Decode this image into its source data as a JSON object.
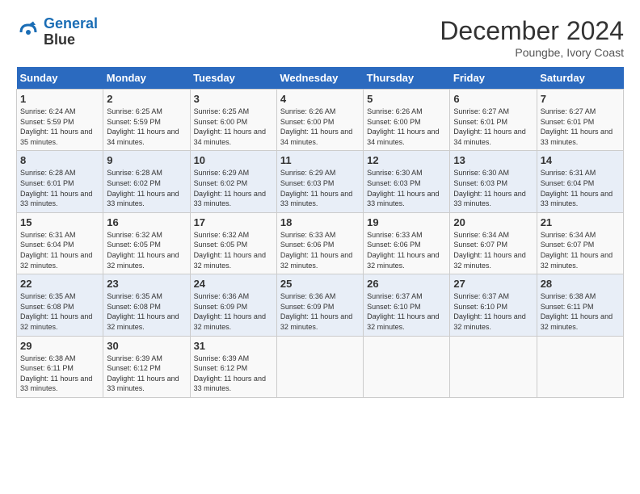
{
  "header": {
    "logo_line1": "General",
    "logo_line2": "Blue",
    "month": "December 2024",
    "location": "Poungbe, Ivory Coast"
  },
  "days_of_week": [
    "Sunday",
    "Monday",
    "Tuesday",
    "Wednesday",
    "Thursday",
    "Friday",
    "Saturday"
  ],
  "weeks": [
    [
      {
        "day": "1",
        "sunrise": "6:24 AM",
        "sunset": "5:59 PM",
        "daylight": "11 hours and 35 minutes."
      },
      {
        "day": "2",
        "sunrise": "6:25 AM",
        "sunset": "5:59 PM",
        "daylight": "11 hours and 34 minutes."
      },
      {
        "day": "3",
        "sunrise": "6:25 AM",
        "sunset": "6:00 PM",
        "daylight": "11 hours and 34 minutes."
      },
      {
        "day": "4",
        "sunrise": "6:26 AM",
        "sunset": "6:00 PM",
        "daylight": "11 hours and 34 minutes."
      },
      {
        "day": "5",
        "sunrise": "6:26 AM",
        "sunset": "6:00 PM",
        "daylight": "11 hours and 34 minutes."
      },
      {
        "day": "6",
        "sunrise": "6:27 AM",
        "sunset": "6:01 PM",
        "daylight": "11 hours and 34 minutes."
      },
      {
        "day": "7",
        "sunrise": "6:27 AM",
        "sunset": "6:01 PM",
        "daylight": "11 hours and 33 minutes."
      }
    ],
    [
      {
        "day": "8",
        "sunrise": "6:28 AM",
        "sunset": "6:01 PM",
        "daylight": "11 hours and 33 minutes."
      },
      {
        "day": "9",
        "sunrise": "6:28 AM",
        "sunset": "6:02 PM",
        "daylight": "11 hours and 33 minutes."
      },
      {
        "day": "10",
        "sunrise": "6:29 AM",
        "sunset": "6:02 PM",
        "daylight": "11 hours and 33 minutes."
      },
      {
        "day": "11",
        "sunrise": "6:29 AM",
        "sunset": "6:03 PM",
        "daylight": "11 hours and 33 minutes."
      },
      {
        "day": "12",
        "sunrise": "6:30 AM",
        "sunset": "6:03 PM",
        "daylight": "11 hours and 33 minutes."
      },
      {
        "day": "13",
        "sunrise": "6:30 AM",
        "sunset": "6:03 PM",
        "daylight": "11 hours and 33 minutes."
      },
      {
        "day": "14",
        "sunrise": "6:31 AM",
        "sunset": "6:04 PM",
        "daylight": "11 hours and 33 minutes."
      }
    ],
    [
      {
        "day": "15",
        "sunrise": "6:31 AM",
        "sunset": "6:04 PM",
        "daylight": "11 hours and 32 minutes."
      },
      {
        "day": "16",
        "sunrise": "6:32 AM",
        "sunset": "6:05 PM",
        "daylight": "11 hours and 32 minutes."
      },
      {
        "day": "17",
        "sunrise": "6:32 AM",
        "sunset": "6:05 PM",
        "daylight": "11 hours and 32 minutes."
      },
      {
        "day": "18",
        "sunrise": "6:33 AM",
        "sunset": "6:06 PM",
        "daylight": "11 hours and 32 minutes."
      },
      {
        "day": "19",
        "sunrise": "6:33 AM",
        "sunset": "6:06 PM",
        "daylight": "11 hours and 32 minutes."
      },
      {
        "day": "20",
        "sunrise": "6:34 AM",
        "sunset": "6:07 PM",
        "daylight": "11 hours and 32 minutes."
      },
      {
        "day": "21",
        "sunrise": "6:34 AM",
        "sunset": "6:07 PM",
        "daylight": "11 hours and 32 minutes."
      }
    ],
    [
      {
        "day": "22",
        "sunrise": "6:35 AM",
        "sunset": "6:08 PM",
        "daylight": "11 hours and 32 minutes."
      },
      {
        "day": "23",
        "sunrise": "6:35 AM",
        "sunset": "6:08 PM",
        "daylight": "11 hours and 32 minutes."
      },
      {
        "day": "24",
        "sunrise": "6:36 AM",
        "sunset": "6:09 PM",
        "daylight": "11 hours and 32 minutes."
      },
      {
        "day": "25",
        "sunrise": "6:36 AM",
        "sunset": "6:09 PM",
        "daylight": "11 hours and 32 minutes."
      },
      {
        "day": "26",
        "sunrise": "6:37 AM",
        "sunset": "6:10 PM",
        "daylight": "11 hours and 32 minutes."
      },
      {
        "day": "27",
        "sunrise": "6:37 AM",
        "sunset": "6:10 PM",
        "daylight": "11 hours and 32 minutes."
      },
      {
        "day": "28",
        "sunrise": "6:38 AM",
        "sunset": "6:11 PM",
        "daylight": "11 hours and 32 minutes."
      }
    ],
    [
      {
        "day": "29",
        "sunrise": "6:38 AM",
        "sunset": "6:11 PM",
        "daylight": "11 hours and 33 minutes."
      },
      {
        "day": "30",
        "sunrise": "6:39 AM",
        "sunset": "6:12 PM",
        "daylight": "11 hours and 33 minutes."
      },
      {
        "day": "31",
        "sunrise": "6:39 AM",
        "sunset": "6:12 PM",
        "daylight": "11 hours and 33 minutes."
      },
      null,
      null,
      null,
      null
    ]
  ]
}
